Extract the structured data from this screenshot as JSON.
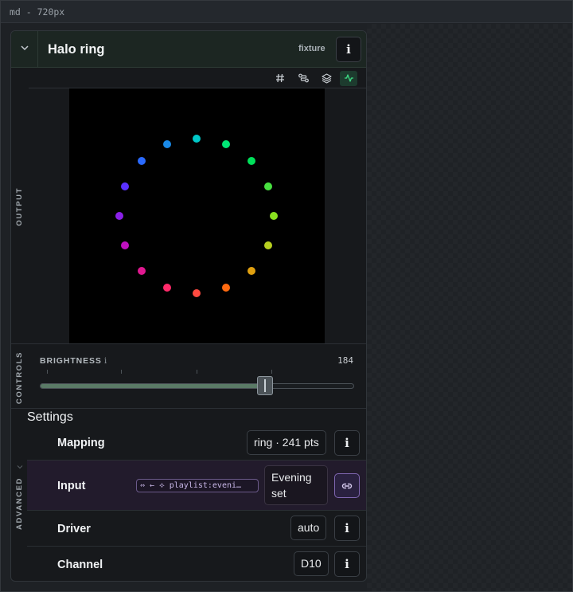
{
  "window": {
    "title": "md - 720px"
  },
  "card": {
    "title": "Halo ring",
    "kind": "fixture",
    "info_icon": "i"
  },
  "sections": {
    "output": "OUTPUT",
    "controls": "CONTROLS",
    "advanced": "ADVANCED"
  },
  "output_toolbar": {
    "tools": [
      {
        "icon": "hash-icon"
      },
      {
        "icon": "route-icon"
      },
      {
        "icon": "layers-icon"
      },
      {
        "icon": "activity-icon",
        "active": true
      }
    ]
  },
  "output_preview": {
    "shape": "ring",
    "pixel_colors": [
      "#00c8c8",
      "#00e676",
      "#00e05a",
      "#48e040",
      "#8ae020",
      "#b8d020",
      "#e0a010",
      "#ff6a10",
      "#ff4a40",
      "#ff2a6a",
      "#e01890",
      "#c010c0",
      "#8a20e8",
      "#5a30ff",
      "#2a6aff",
      "#1a8ae8"
    ]
  },
  "controls": {
    "brightness_label": "BRIGHTNESS",
    "brightness_info": "i",
    "brightness_value": "184",
    "brightness_fraction": 0.72
  },
  "settings": {
    "heading": "Settings",
    "rows": [
      {
        "label": "Mapping",
        "value": "ring · 241 pts",
        "info": "i"
      },
      {
        "label": "Input",
        "binding": "⇔ ← ⟡ playlist:eveni…",
        "value": "Evening set",
        "link_icon": "link-icon"
      },
      {
        "label": "Driver",
        "value": "auto",
        "info": "i"
      },
      {
        "label": "Channel",
        "value": "D10",
        "info": "i"
      }
    ]
  }
}
